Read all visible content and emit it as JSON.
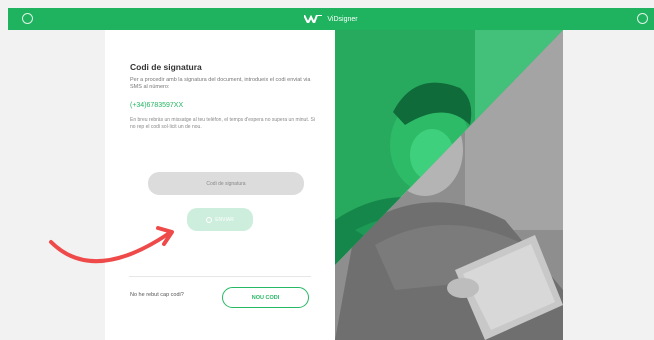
{
  "topbar": {
    "brand": "ViDsigner",
    "color": "#1fb35f"
  },
  "form": {
    "title": "Codi de signatura",
    "description": "Per a procedir amb la signatura del document, introdueix el codi enviat via SMS al número:",
    "phone": "(+34)6783597XX",
    "info": "En breu rebràs un missatge al teu telèfon, el temps d'espera no supera un minut. Si no rep el codi sol·licit un de nou.",
    "code_placeholder": "Codi de signatura",
    "send_label": "ENVIAR",
    "no_code_text": "No he rebut cap codi?",
    "new_code_label": "NOU CODI"
  },
  "icons": {
    "topbar_left": "settings-icon",
    "topbar_right": "settings-icon",
    "brand": "vidsigner-logo-icon",
    "send": "circle-icon",
    "arrow": "curved-arrow-icon"
  },
  "colors": {
    "green": "#22b460",
    "arrow": "#ef4a4a"
  }
}
